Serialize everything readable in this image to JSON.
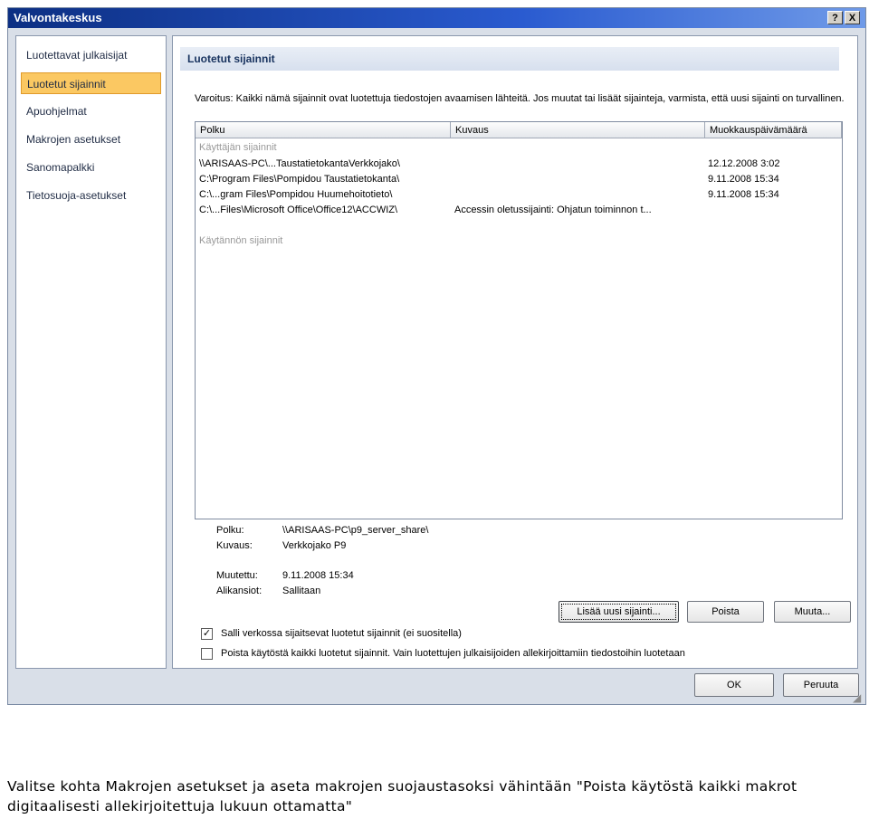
{
  "window": {
    "title": "Valvontakeskus",
    "help_btn": "?",
    "close_btn": "X"
  },
  "nav": {
    "items": [
      {
        "label": "Luotettavat julkaisijat",
        "active": false
      },
      {
        "label": "Luotetut sijainnit",
        "active": true
      },
      {
        "label": "Apuohjelmat",
        "active": false
      },
      {
        "label": "Makrojen asetukset",
        "active": false
      },
      {
        "label": "Sanomapalkki",
        "active": false
      },
      {
        "label": "Tietosuoja-asetukset",
        "active": false
      }
    ]
  },
  "main": {
    "section_title": "Luotetut sijainnit",
    "warning": "Varoitus: Kaikki nämä sijainnit ovat luotettuja tiedostojen avaamisen lähteitä. Jos muutat tai lisäät sijainteja, varmista, että uusi sijainti on turvallinen.",
    "columns": [
      "Polku",
      "Kuvaus",
      "Muokkauspäivämäärä"
    ],
    "user_group": "Käyttäjän sijainnit",
    "policy_group": "Käytännön sijainnit",
    "rows": [
      {
        "path": "\\\\ARISAAS-PC\\...TaustatietokantaVerkkojako\\",
        "desc": "",
        "date": "12.12.2008 3:02"
      },
      {
        "path": "C:\\Program Files\\Pompidou Taustatietokanta\\",
        "desc": "",
        "date": "9.11.2008 15:34"
      },
      {
        "path": "C:\\...gram Files\\Pompidou Huumehoitotieto\\",
        "desc": "",
        "date": "9.11.2008 15:34"
      },
      {
        "path": "C:\\...Files\\Microsoft Office\\Office12\\ACCWIZ\\",
        "desc": "Accessin oletussijainti: Ohjatun toiminnon t...",
        "date": ""
      }
    ],
    "details": {
      "path_label": "Polku:",
      "path_value": "\\\\ARISAAS-PC\\p9_server_share\\",
      "desc_label": "Kuvaus:",
      "desc_value": "Verkkojako P9",
      "modified_label": "Muutettu:",
      "modified_value": "9.11.2008 15:34",
      "subfolders_label": "Alikansiot:",
      "subfolders_value": "Sallitaan"
    },
    "buttons": {
      "add": "Lisää uusi sijainti...",
      "remove": "Poista",
      "modify": "Muuta..."
    },
    "checkboxes": [
      {
        "label": "Salli verkossa sijaitsevat luotetut sijainnit (ei suositella)",
        "checked": true
      },
      {
        "label": "Poista käytöstä kaikki luotetut sijainnit. Vain luotettujen julkaisijoiden allekirjoittamiin tiedostoihin luotetaan",
        "checked": false
      }
    ]
  },
  "footer": {
    "ok": "OK",
    "cancel": "Peruuta"
  },
  "caption": "Valitse kohta Makrojen asetukset ja aseta makrojen suojaustasoksi vähintään \"Poista käytöstä kaikki makrot digitaalisesti allekirjoitettuja lukuun ottamatta\""
}
